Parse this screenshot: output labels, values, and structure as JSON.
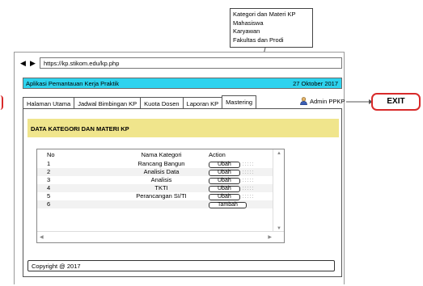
{
  "dropdown": {
    "items": [
      "Kategori dan Materi KP",
      "Mahasiswa",
      "Karyawan",
      "Fakultas dan Prodi"
    ]
  },
  "browser": {
    "back_icon": "◀",
    "forward_icon": "▶",
    "url": "https://kp.stikom.edu/kp.php"
  },
  "appbar": {
    "title": "Aplikasi Pemantauan Kerja Praktik",
    "date": "27 Oktober 2017",
    "color": "#2ed3ee"
  },
  "tabs": [
    "Halaman Utama",
    "Jadwal Bimbingan KP",
    "Kuota Dosen",
    "Laporan KP",
    "Mastering"
  ],
  "user": {
    "name": "Admin PPKP",
    "icon": "person-icon"
  },
  "section": {
    "title": "DATA KATEGORI DAN MATERI KP",
    "color": "#f0e58c"
  },
  "table": {
    "headers": {
      "no": "No",
      "name": "Nama Kategori",
      "action": "Action"
    },
    "rows": [
      {
        "no": "1",
        "name": "Rancang Bangun",
        "action": "Ubah"
      },
      {
        "no": "2",
        "name": "Analisis Data",
        "action": "Ubah"
      },
      {
        "no": "3",
        "name": "Analisis",
        "action": "Ubah"
      },
      {
        "no": "4",
        "name": "TKTI",
        "action": "Ubah"
      },
      {
        "no": "5",
        "name": "Perancangan SI/TI",
        "action": "Ubah"
      },
      {
        "no": "6",
        "name": "",
        "action": "Tambah"
      }
    ],
    "dots": ":::::"
  },
  "footer": {
    "copyright": "Copyright @ 2017"
  },
  "exit": {
    "label": "EXIT",
    "border_color": "#d82a2a"
  }
}
